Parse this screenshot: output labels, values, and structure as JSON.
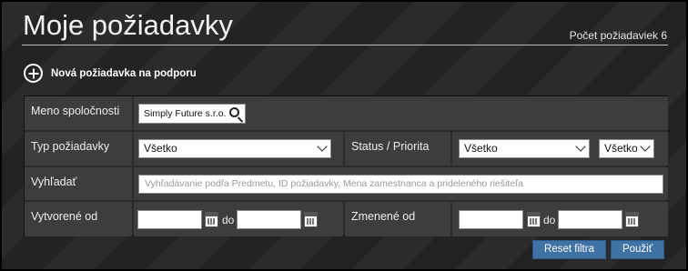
{
  "page": {
    "title": "Moje požiadavky",
    "count_label": "Počet požiadaviek 6"
  },
  "actions": {
    "new_request": "Nová požiadavka na podporu",
    "plus_icon": "plus-circle-icon"
  },
  "filters": {
    "company": {
      "label": "Meno spoločnosti",
      "value": "Simply Future s.r.o."
    },
    "type": {
      "label": "Typ požiadavky",
      "value": "Všetko"
    },
    "status": {
      "label": "Status / Priorita",
      "status_value": "Všetko",
      "priority_value": "Všetko"
    },
    "search": {
      "label": "Vyhľadať",
      "placeholder": "Vyhľadávanie podľa Predmetu, ID požiadavky, Mena zamestnanca a prideleného riešiteľa"
    },
    "created": {
      "label": "Vytvorené od",
      "from": "",
      "to_label": "do",
      "to": ""
    },
    "modified": {
      "label": "Zmenené od",
      "from": "",
      "to_label": "do",
      "to": ""
    }
  },
  "buttons": {
    "reset": "Reset filtra",
    "apply": "Použiť"
  }
}
